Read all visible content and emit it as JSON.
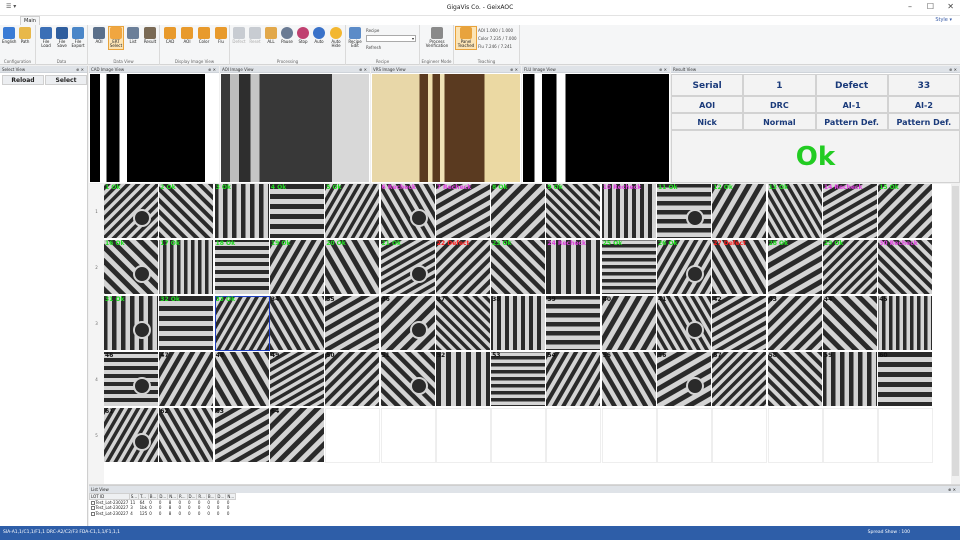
{
  "window": {
    "title": "GigaVis Co. - GeixAOC",
    "style_label": "Style ▾"
  },
  "ribbon": {
    "tab": "Main",
    "groups": [
      {
        "label": "Configuration",
        "buttons": [
          "English",
          "Path"
        ]
      },
      {
        "label": "Data",
        "buttons": [
          "File Load",
          "File Save",
          "File Export"
        ]
      },
      {
        "label": "Data View",
        "buttons": [
          "AOI",
          "ERT Select",
          "List",
          "Result"
        ]
      },
      {
        "label": "Display Image View",
        "buttons": [
          "CAD",
          "AOI",
          "Color",
          "Flu"
        ]
      },
      {
        "label": "Processing",
        "buttons": [
          "Defect",
          "Reset",
          "ALL",
          "Pause",
          "Stop",
          "Auto",
          "Auto Hide"
        ]
      },
      {
        "label": "Recipe",
        "buttons": [
          "Recipe Edit"
        ],
        "recipe_label": "Recipe",
        "refresh": "Refresh"
      },
      {
        "label": "Engineer Mode",
        "buttons": [
          "Process Verification"
        ]
      },
      {
        "label": "Teaching",
        "buttons": [
          "Panel Teached"
        ]
      }
    ],
    "stats": [
      {
        "k": "AOI",
        "v": "1.000 / 1.000"
      },
      {
        "k": "Color",
        "v": "7.235 / 7.000"
      },
      {
        "k": "Flu",
        "v": "7.246 / 7.241"
      }
    ]
  },
  "panels": {
    "select": "Select View",
    "cad": "CAD Image View",
    "aoi": "AOI Image View",
    "vrs": "VRS Image View",
    "flu": "FLU Image View",
    "result": "Result View",
    "list": "List View"
  },
  "select_view": {
    "reload": "Reload",
    "select": "Select"
  },
  "result_view": {
    "rows": [
      [
        "Serial",
        "1",
        "Defect",
        "33"
      ],
      [
        "AOI",
        "DRC",
        "AI-1",
        "AI-2"
      ],
      [
        "Nick",
        "Normal",
        "Pattern Def.",
        "Pattern Def."
      ]
    ],
    "verdict": "Ok",
    "verdict_color": "#22cc22"
  },
  "grid": {
    "row_numbers": [
      "1",
      "2",
      "3",
      "4",
      "5"
    ],
    "tiles": [
      "1 Ok",
      "2 Ok",
      "3 Ok",
      "4 Ok",
      "5 Ok",
      "6 Recheck",
      "7 Recheck",
      "8 Ok",
      "9 Ok",
      "10 Recheck",
      "11 Ok",
      "12 Ok",
      "13 Ok",
      "14 Recheck",
      "15 Ok",
      "16 Ok",
      "17 Ok",
      "18 Ok",
      "19 Ok",
      "20 Ok",
      "21 Ok",
      "22 Defect",
      "23 Ok",
      "24 Recheck",
      "25 Ok",
      "26 Ok",
      "27 Defect",
      "28 Ok",
      "29 Ok",
      "30 Recheck",
      "31 Ok",
      "32 Ok",
      "33 Ok",
      "34",
      "35",
      "36",
      "37",
      "38",
      "39",
      "40",
      "41",
      "42",
      "43",
      "44",
      "45",
      "46",
      "47",
      "48",
      "49",
      "50",
      "51",
      "52",
      "53",
      "54",
      "55",
      "56",
      "57",
      "58",
      "59",
      "60",
      "61",
      "62",
      "63",
      "64"
    ],
    "status_colors": {
      "Ok": "#22dd22",
      "Recheck": "#e040e0",
      "Defect": "#ff2020",
      "none": "#111111"
    },
    "selected_index": 32
  },
  "list_view": {
    "columns": [
      "LOT ID",
      "S...",
      "T...",
      "B...",
      "D...",
      "N...",
      "R...",
      "D...",
      "R...",
      "B...",
      "D...",
      "N..."
    ],
    "rows": [
      [
        "Test_Lot-230227",
        "11",
        "64",
        "0",
        "0",
        "8",
        "0",
        "0",
        "0",
        "0",
        "0",
        "0"
      ],
      [
        "Test_Lot-230227",
        "3",
        "1bk",
        "0",
        "0",
        "8",
        "0",
        "0",
        "0",
        "0",
        "0",
        "0"
      ],
      [
        "Test_Lot-230227",
        "4",
        "125",
        "0",
        "0",
        "8",
        "0",
        "0",
        "0",
        "0",
        "0",
        "0"
      ]
    ]
  },
  "status_bar": {
    "left": "SIA-A1,1/C1,1/F1,1 DRC-A2/C2/F3 FDA-C1,1,1/F1,1,1",
    "right": "Spread Show : 100"
  }
}
